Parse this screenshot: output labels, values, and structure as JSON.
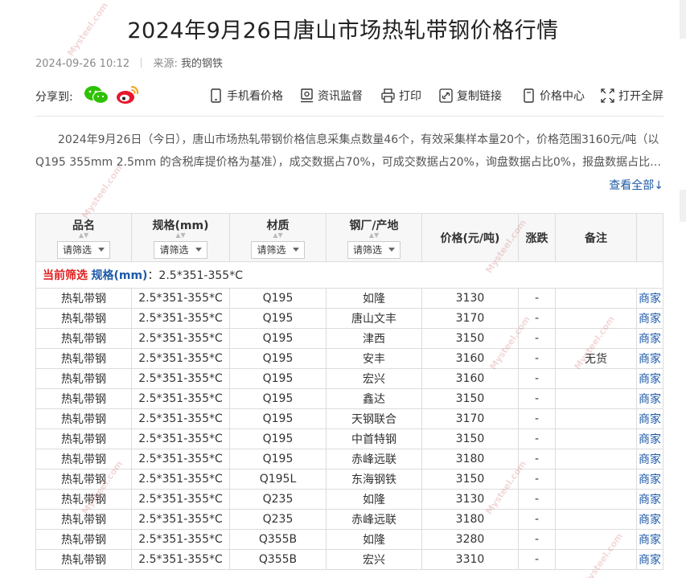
{
  "article": {
    "title": "2024年9月26日唐山市场热轧带钢价格行情",
    "date": "2024-09-26 10:12",
    "source_label": "来源:",
    "source_name": "我的钢铁"
  },
  "share": {
    "label": "分享到:",
    "icons": [
      "wechat-icon",
      "weibo-icon"
    ]
  },
  "toolbar": [
    {
      "label": "手机看价格",
      "icon": "mobile-icon"
    },
    {
      "label": "资讯监督",
      "icon": "supervise-icon"
    },
    {
      "label": "打印",
      "icon": "printer-icon"
    },
    {
      "label": "复制链接",
      "icon": "link-icon"
    },
    {
      "label": "价格中心",
      "icon": "price-center-icon"
    },
    {
      "label": "打开全屏",
      "icon": "fullscreen-icon"
    }
  ],
  "summary": {
    "line1": "2024年9月26日（今日），唐山市场热轧带钢价格信息采集点数量46个，有效采集样本量20个，价格范围3160元/吨（以",
    "line2": "Q195 355mm 2.5mm 的含税库提价格为基准），成交数据占70%，可成交数据占20%，询盘数据占比0%，报盘数据占比1...",
    "view_all": "查看全部↓"
  },
  "table": {
    "headers": {
      "name": "品名",
      "spec": "规格(mm)",
      "material": "材质",
      "mill": "钢厂/产地",
      "price": "价格(元/吨)",
      "change": "涨跌",
      "note": "备注"
    },
    "filter_label": "请筛选",
    "current_filter": {
      "label": "当前筛选",
      "key": "规格(mm)",
      "value": "：2.5*351-355*C"
    },
    "merchant_label": "商家",
    "rows": [
      {
        "name": "热轧带钢",
        "spec": "2.5*351-355*C",
        "material": "Q195",
        "mill": "如隆",
        "price": "3130",
        "change": "-",
        "note": ""
      },
      {
        "name": "热轧带钢",
        "spec": "2.5*351-355*C",
        "material": "Q195",
        "mill": "唐山文丰",
        "price": "3170",
        "change": "-",
        "note": ""
      },
      {
        "name": "热轧带钢",
        "spec": "2.5*351-355*C",
        "material": "Q195",
        "mill": "津西",
        "price": "3150",
        "change": "-",
        "note": ""
      },
      {
        "name": "热轧带钢",
        "spec": "2.5*351-355*C",
        "material": "Q195",
        "mill": "安丰",
        "price": "3160",
        "change": "-",
        "note": "无货"
      },
      {
        "name": "热轧带钢",
        "spec": "2.5*351-355*C",
        "material": "Q195",
        "mill": "宏兴",
        "price": "3160",
        "change": "-",
        "note": ""
      },
      {
        "name": "热轧带钢",
        "spec": "2.5*351-355*C",
        "material": "Q195",
        "mill": "鑫达",
        "price": "3150",
        "change": "-",
        "note": ""
      },
      {
        "name": "热轧带钢",
        "spec": "2.5*351-355*C",
        "material": "Q195",
        "mill": "天钢联合",
        "price": "3170",
        "change": "-",
        "note": ""
      },
      {
        "name": "热轧带钢",
        "spec": "2.5*351-355*C",
        "material": "Q195",
        "mill": "中首特钢",
        "price": "3150",
        "change": "-",
        "note": ""
      },
      {
        "name": "热轧带钢",
        "spec": "2.5*351-355*C",
        "material": "Q195",
        "mill": "赤峰远联",
        "price": "3180",
        "change": "-",
        "note": ""
      },
      {
        "name": "热轧带钢",
        "spec": "2.5*351-355*C",
        "material": "Q195L",
        "mill": "东海钢铁",
        "price": "3150",
        "change": "-",
        "note": ""
      },
      {
        "name": "热轧带钢",
        "spec": "2.5*351-355*C",
        "material": "Q235",
        "mill": "如隆",
        "price": "3130",
        "change": "-",
        "note": ""
      },
      {
        "name": "热轧带钢",
        "spec": "2.5*351-355*C",
        "material": "Q235",
        "mill": "赤峰远联",
        "price": "3180",
        "change": "-",
        "note": ""
      },
      {
        "name": "热轧带钢",
        "spec": "2.5*351-355*C",
        "material": "Q355B",
        "mill": "如隆",
        "price": "3280",
        "change": "-",
        "note": ""
      },
      {
        "name": "热轧带钢",
        "spec": "2.5*351-355*C",
        "material": "Q355B",
        "mill": "宏兴",
        "price": "3310",
        "change": "-",
        "note": ""
      }
    ]
  },
  "watermark": {
    "text": "Mysteel.com"
  },
  "colors": {
    "link": "#1e5aa8",
    "filter_label": "#e02020",
    "wechat": "#2dc100",
    "weibo": "#e6162d"
  }
}
